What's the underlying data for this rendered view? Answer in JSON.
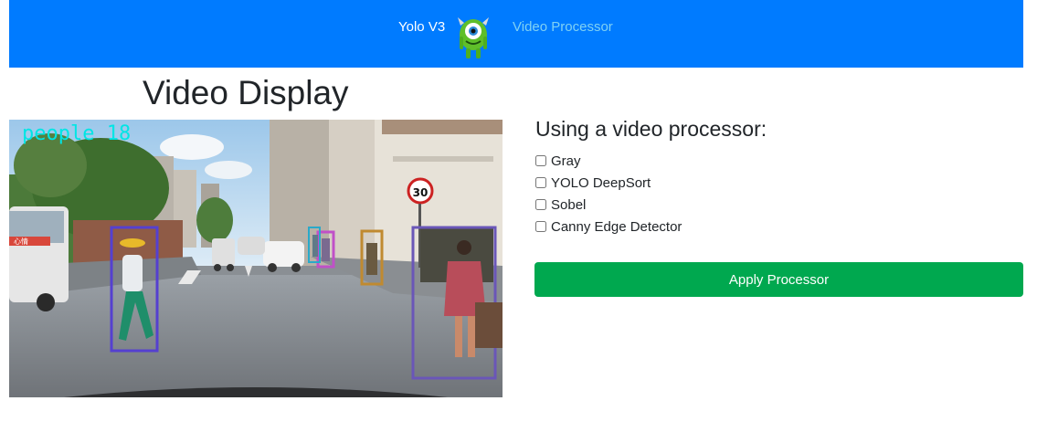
{
  "navbar": {
    "brand": "Yolo V3",
    "logo_icon": "monster-mascot-icon",
    "link": "Video Processor",
    "background": "#007bff"
  },
  "main": {
    "title": "Video Display",
    "video": {
      "overlay_text": "people 18",
      "overlay_color": "#00e5e5",
      "speed_sign": "30",
      "shop_sign": "心情"
    }
  },
  "panel": {
    "title": "Using a video processor:",
    "options": [
      {
        "label": "Gray",
        "checked": false
      },
      {
        "label": "YOLO DeepSort",
        "checked": false
      },
      {
        "label": "Sobel",
        "checked": false
      },
      {
        "label": "Canny Edge Detector",
        "checked": false
      }
    ],
    "apply_label": "Apply Processor",
    "apply_color": "#00a84f"
  }
}
